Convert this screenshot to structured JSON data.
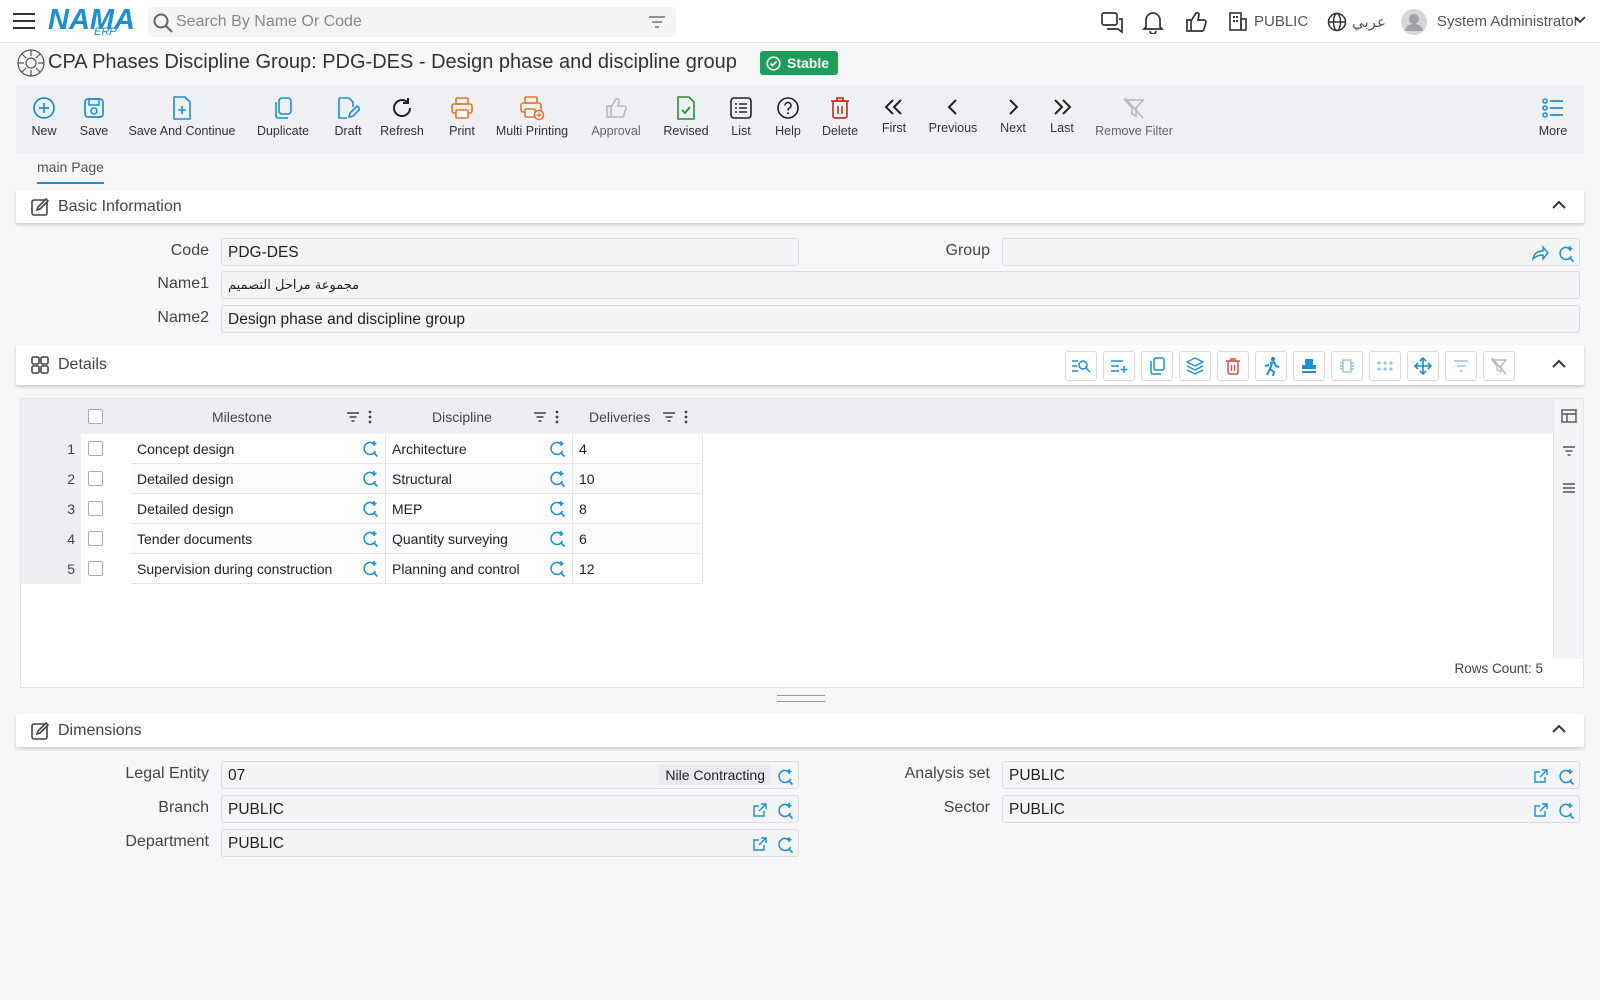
{
  "header": {
    "search_placeholder": "Search By Name Or Code",
    "logo_text": "NAMA",
    "logo_sub": "ERP",
    "company": "PUBLIC",
    "language": "عربي",
    "user": "System Administrator"
  },
  "page": {
    "title": "CPA Phases Discipline Group: PDG-DES - Design phase and discipline group",
    "status": "Stable"
  },
  "toolbar": {
    "new": "New",
    "save": "Save",
    "save_continue": "Save And Continue",
    "duplicate": "Duplicate",
    "draft": "Draft",
    "refresh": "Refresh",
    "print": "Print",
    "multi_printing": "Multi Printing",
    "approval": "Approval",
    "revised": "Revised",
    "list": "List",
    "help": "Help",
    "delete": "Delete",
    "first": "First",
    "previous": "Previous",
    "next": "Next",
    "last": "Last",
    "remove_filter": "Remove Filter",
    "more": "More"
  },
  "tabs": {
    "main": "main Page"
  },
  "basic_info": {
    "title": "Basic Information",
    "code_label": "Code",
    "code_value": "PDG-DES",
    "group_label": "Group",
    "group_value": "",
    "name1_label": "Name1",
    "name1_value": "مجموعة مراحل التصميم",
    "name2_label": "Name2",
    "name2_value": "Design phase and discipline group"
  },
  "details": {
    "title": "Details",
    "columns": {
      "milestone": "Milestone",
      "discipline": "Discipline",
      "deliveries": "Deliveries"
    },
    "rows": [
      {
        "n": "1",
        "milestone": "Concept design",
        "discipline": "Architecture",
        "deliveries": "4"
      },
      {
        "n": "2",
        "milestone": "Detailed design",
        "discipline": "Structural",
        "deliveries": "10"
      },
      {
        "n": "3",
        "milestone": "Detailed design",
        "discipline": "MEP",
        "deliveries": "8"
      },
      {
        "n": "4",
        "milestone": "Tender documents",
        "discipline": "Quantity surveying",
        "deliveries": "6"
      },
      {
        "n": "5",
        "milestone": "Supervision during construction",
        "discipline": "Planning and control",
        "deliveries": "12"
      }
    ],
    "rows_count": "Rows Count: 5"
  },
  "dimensions": {
    "title": "Dimensions",
    "legal_entity_label": "Legal Entity",
    "legal_entity_value": "07",
    "legal_entity_tag": "Nile Contracting",
    "analysis_set_label": "Analysis set",
    "analysis_set_value": "PUBLIC",
    "branch_label": "Branch",
    "branch_value": "PUBLIC",
    "sector_label": "Sector",
    "sector_value": "PUBLIC",
    "department_label": "Department",
    "department_value": "PUBLIC"
  },
  "colors": {
    "accent": "#1b8fd4",
    "stable_badge": "#1e9e5a",
    "print_orange": "#e8742c",
    "delete_red": "#c0392b",
    "revised_green": "#2e8b3e"
  }
}
